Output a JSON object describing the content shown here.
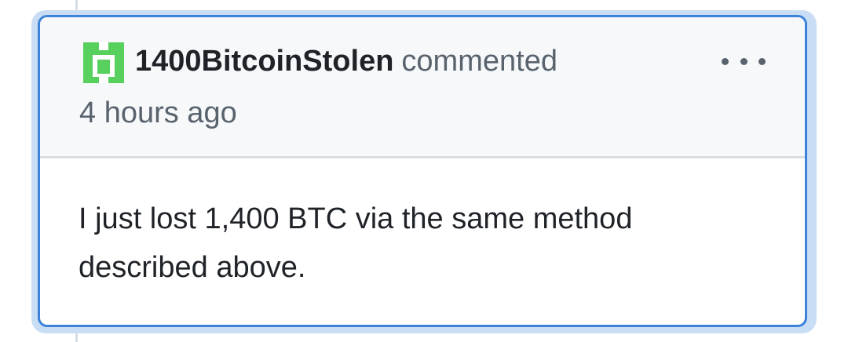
{
  "comment": {
    "author": "1400BitcoinStolen",
    "action": "commented",
    "timestamp": "4 hours ago",
    "body": "I just lost 1,400 BTC via the same method described above.",
    "menu_icon": "kebab-horizontal-icon",
    "avatar_icon": "identicon-avatar",
    "avatar_color": "#57d05e"
  }
}
